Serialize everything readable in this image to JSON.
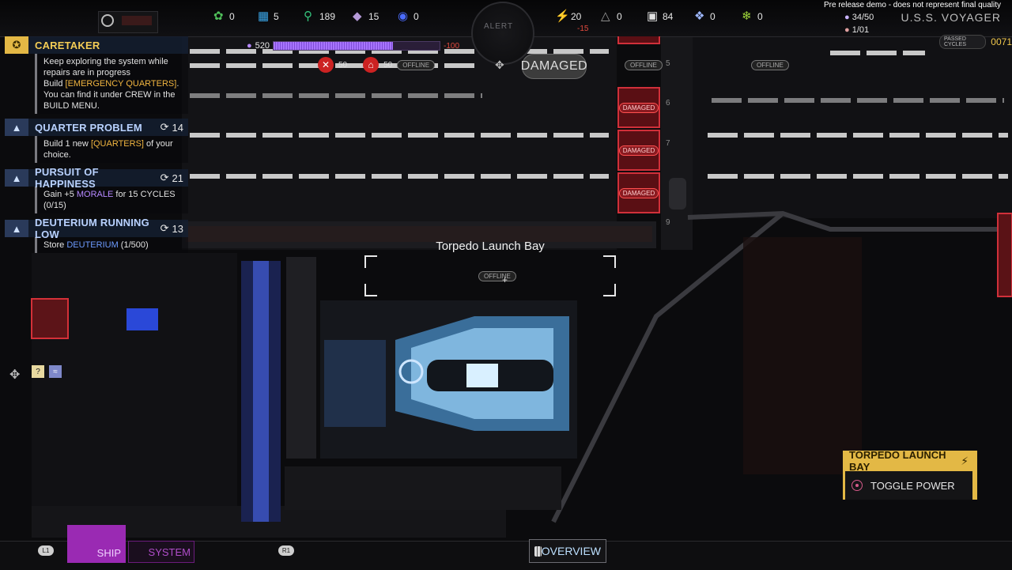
{
  "top_bar": {
    "resources": [
      {
        "name": "leaf-icon",
        "value": "0",
        "color": "#4fbf5a"
      },
      {
        "name": "chip-icon",
        "value": "5",
        "color": "#3aa6e8"
      },
      {
        "name": "flask-icon",
        "value": "189",
        "color": "#35c47d"
      },
      {
        "name": "crystal-icon",
        "value": "15",
        "color": "#b59ad8"
      },
      {
        "name": "deuterium-icon",
        "value": "0",
        "color": "#4b6cff"
      },
      {
        "name": "energy-icon",
        "value": "20",
        "delta": "-15",
        "color": "#f4c237"
      },
      {
        "name": "dilithium-icon",
        "value": "0",
        "color": "#9b9b9b"
      },
      {
        "name": "cargo-icon",
        "value": "84",
        "color": "#e0e0e0"
      },
      {
        "name": "shuttle-icon",
        "value": "0",
        "color": "#9db7ff"
      },
      {
        "name": "sprout-icon",
        "value": "0",
        "color": "#9ed63a"
      }
    ],
    "crew": {
      "primary": "34/50",
      "secondary": "1/01"
    },
    "demo_notice": "Pre release demo - does not represent final quality",
    "ship_name": "U.S.S. VOYAGER",
    "alert_label": "ALERT",
    "passed_cycles_label": "PASSED CYCLES",
    "passed_cycles_value": "0071"
  },
  "quests": [
    {
      "title": "CARETAKER",
      "style": "gold",
      "cycles": "",
      "lines": [
        {
          "text": "Keep exploring the system while repairs are in progress"
        },
        {
          "text": "Build ",
          "hl": "[EMERGENCY QUARTERS]",
          "hl_type": "gold",
          "after": "."
        },
        {
          "text": "You can find it under CREW in the BUILD MENU."
        }
      ]
    },
    {
      "title": "QUARTER PROBLEM",
      "style": "blue",
      "cycles": "14",
      "lines": [
        {
          "text": "Build 1 new ",
          "hl": "[QUARTERS]",
          "hl_type": "gold",
          "after": " of your choice."
        }
      ]
    },
    {
      "title": "PURSUIT OF HAPPINESS",
      "style": "blue",
      "cycles": "21",
      "lines": [
        {
          "text": "Gain +5 ",
          "hl": "MORALE",
          "hl_type": "purple",
          "after": " for 15 CYCLES"
        },
        {
          "text": "(0/15)"
        }
      ]
    },
    {
      "title": "DEUTERIUM RUNNING LOW",
      "style": "blue",
      "cycles": "13",
      "lines": [
        {
          "text": "Store ",
          "hl": "DEUTERIUM",
          "hl_type": "blue",
          "after": " (1/500)"
        }
      ]
    }
  ],
  "morale": {
    "value": "520",
    "delta": "-100",
    "fill_fraction": 0.72
  },
  "room_status": {
    "crew_required": "50",
    "power_required": "50",
    "offline_label": "OFFLINE"
  },
  "ship_status": "DAMAGED",
  "damaged_tile_label": "DAMAGED",
  "deck_numbers": [
    "5",
    "6",
    "7",
    "9"
  ],
  "room": {
    "title": "Torpedo Launch Bay",
    "offline_label": "OFFLINE"
  },
  "context_menu": {
    "title": "TORPEDO LAUNCH BAY",
    "action": "TOGGLE POWER"
  },
  "bottom_bar": {
    "l1": "L1",
    "r1": "R1",
    "ship_tab": "SHIP",
    "system_tab": "SYSTEM",
    "overview": "OVERVIEW"
  },
  "side_help": "?"
}
